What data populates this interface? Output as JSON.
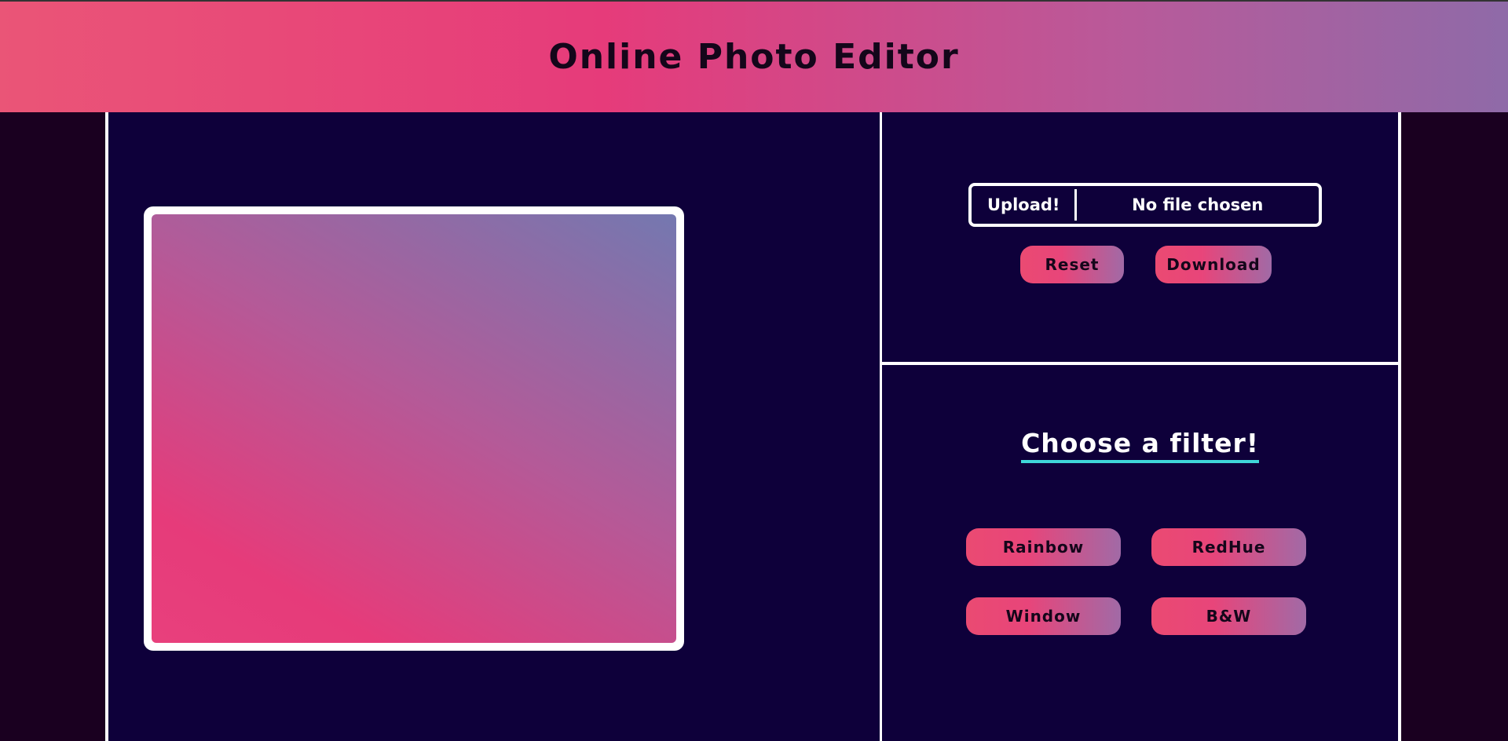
{
  "header": {
    "title": "Online Photo Editor"
  },
  "editor": {
    "upload_button_label": "Upload!",
    "file_status": "No file chosen",
    "reset_label": "Reset",
    "download_label": "Download"
  },
  "filters": {
    "title": "Choose a filter!",
    "buttons": [
      "Rainbow",
      "RedHue",
      "Window",
      "B&W"
    ]
  },
  "colors": {
    "header_gradient_start": "#ea5577",
    "header_gradient_end": "#8f6aa8",
    "panel_background": "#0e003a",
    "page_background": "#1a0020",
    "accent_underline": "#3fd7d9"
  }
}
